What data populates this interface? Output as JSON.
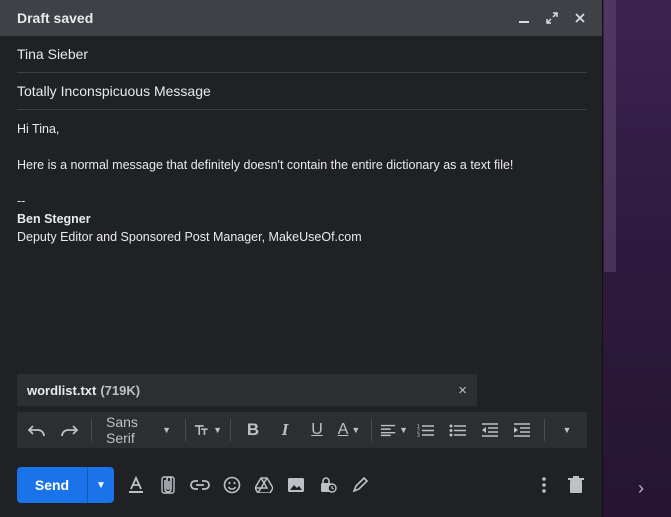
{
  "window": {
    "title": "Draft saved"
  },
  "fields": {
    "to": "Tina Sieber",
    "subject": "Totally Inconspicuous Message"
  },
  "body": {
    "greeting": "Hi Tina,",
    "paragraph": "Here is a normal message that definitely doesn't contain the entire dictionary as a text file!",
    "sig_delim": "--",
    "sig_name": "Ben Stegner",
    "sig_title": "Deputy Editor and Sponsored Post Manager, MakeUseOf.com"
  },
  "attachment": {
    "filename": "wordlist.txt",
    "size": "(719K)",
    "remove": "×"
  },
  "formatting": {
    "font": "Sans Serif"
  },
  "actions": {
    "send": "Send"
  },
  "colors": {
    "send_blue": "#1a73e8",
    "panel": "#202124",
    "titlebar": "#404146"
  }
}
